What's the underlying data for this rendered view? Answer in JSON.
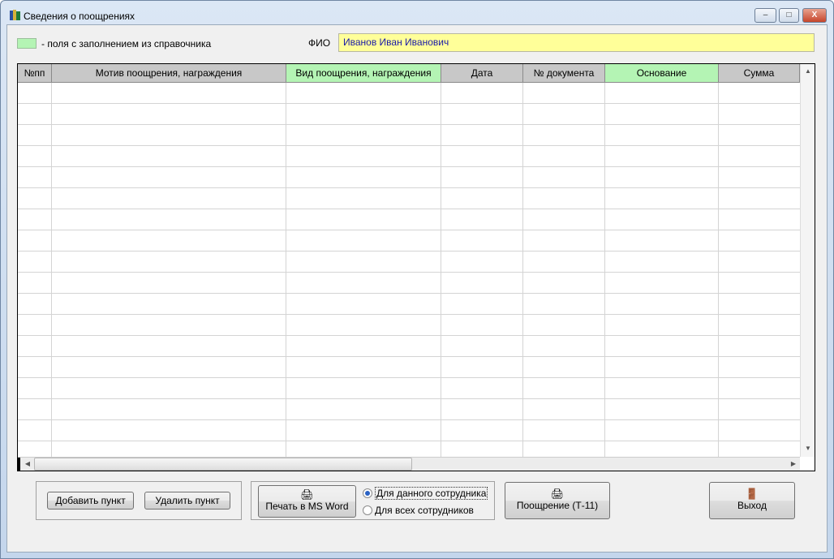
{
  "window": {
    "title": "Сведения о поощрениях",
    "icon": "books-icon"
  },
  "legend": {
    "text": "- поля с заполнением из справочника",
    "color": "#b4f4b4"
  },
  "fio": {
    "label": "ФИО",
    "value": "Иванов Иван Иванович"
  },
  "table": {
    "columns": [
      {
        "label": "№пп",
        "lookup": false
      },
      {
        "label": "Мотив поощрения, награждения",
        "lookup": false
      },
      {
        "label": "Вид поощрения, награждения",
        "lookup": true
      },
      {
        "label": "Дата",
        "lookup": false
      },
      {
        "label": "№ документа",
        "lookup": false
      },
      {
        "label": "Основание",
        "lookup": true
      },
      {
        "label": "Сумма",
        "lookup": false
      }
    ],
    "rows": []
  },
  "buttons": {
    "add": "Добавить пункт",
    "delete": "Удалить пункт",
    "print_word": "Печать в MS Word",
    "t11": "Поощрение (Т-11)",
    "exit": "Выход"
  },
  "print_options": [
    {
      "label": "Для данного сотрудника",
      "selected": true
    },
    {
      "label": "Для всех сотрудников",
      "selected": false
    }
  ]
}
